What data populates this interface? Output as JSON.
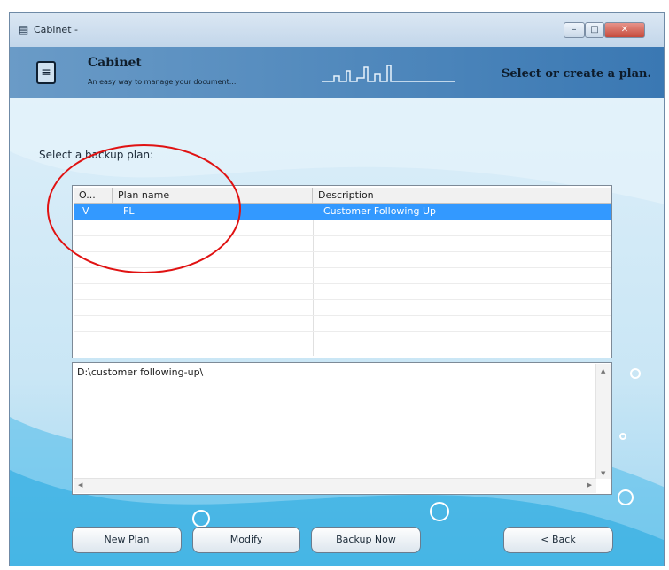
{
  "window": {
    "title": "Cabinet -",
    "controls": {
      "minimize": "–",
      "maximize": "□",
      "close": "✕"
    }
  },
  "header": {
    "app_name": "Cabinet",
    "tagline": "An easy way to manage your document...",
    "step_title": "Select or create a plan."
  },
  "main": {
    "select_label": "Select a backup plan:",
    "table": {
      "columns": [
        "O...",
        "Plan name",
        "Description"
      ],
      "rows": [
        {
          "o": "V",
          "name": "FL",
          "description": "Customer Following Up",
          "selected": true
        }
      ]
    },
    "path_value": "D:\\customer following-up\\"
  },
  "buttons": {
    "new_plan": "New Plan",
    "modify": "Modify",
    "backup_now": "Backup Now",
    "back": "< Back"
  },
  "colors": {
    "selection": "#3399ff",
    "annotation": "#e01212",
    "header_band": "#3a78b3"
  }
}
